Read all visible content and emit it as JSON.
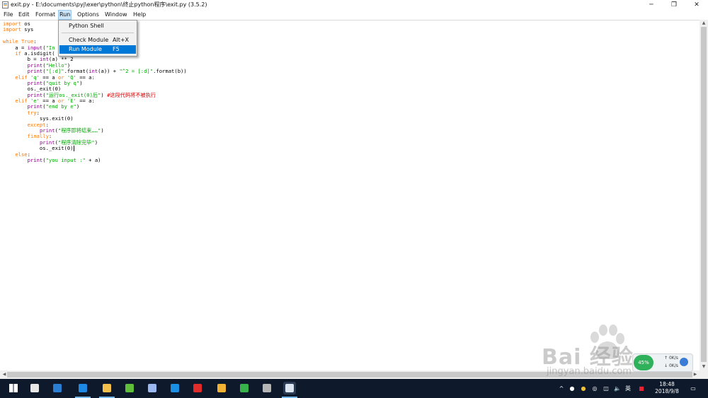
{
  "window": {
    "title": "exit.py - E:\\documents\\pyj\\exer\\python\\终止python程序\\exit.py (3.5.2)",
    "minimize_glyph": "─",
    "maximize_glyph": "❐",
    "close_glyph": "✕"
  },
  "menubar": {
    "items": [
      {
        "label": "File"
      },
      {
        "label": "Edit"
      },
      {
        "label": "Format"
      },
      {
        "label": "Run"
      },
      {
        "label": "Options"
      },
      {
        "label": "Window"
      },
      {
        "label": "Help"
      }
    ],
    "open_menu": "Run"
  },
  "run_menu": {
    "items": [
      {
        "label": "Python Shell",
        "accelerator": ""
      },
      {
        "label": "Check Module",
        "accelerator": "Alt+X"
      },
      {
        "label": "Run Module",
        "accelerator": "F5"
      }
    ],
    "selected": "Run Module"
  },
  "code_lines": [
    [
      {
        "t": "import",
        "c": "kw"
      },
      {
        "t": " os"
      }
    ],
    [
      {
        "t": "import",
        "c": "kw"
      },
      {
        "t": " sys"
      }
    ],
    [],
    [
      {
        "t": "while",
        "c": "kw"
      },
      {
        "t": " "
      },
      {
        "t": "True",
        "c": "kw"
      },
      {
        "t": ":"
      }
    ],
    [
      {
        "t": "    a = "
      },
      {
        "t": "input",
        "c": "bi"
      },
      {
        "t": "("
      },
      {
        "t": "\"In",
        "c": "str"
      }
    ],
    [
      {
        "t": "    "
      },
      {
        "t": "if",
        "c": "kw"
      },
      {
        "t": " a.isdigit("
      }
    ],
    [
      {
        "t": "        b = "
      },
      {
        "t": "int",
        "c": "bi"
      },
      {
        "t": "(a) ** 2"
      }
    ],
    [
      {
        "t": "        "
      },
      {
        "t": "print",
        "c": "bi"
      },
      {
        "t": "("
      },
      {
        "t": "\"Hello\"",
        "c": "str"
      },
      {
        "t": ")"
      }
    ],
    [
      {
        "t": "        "
      },
      {
        "t": "print",
        "c": "bi"
      },
      {
        "t": "("
      },
      {
        "t": "\"[:d]\"",
        "c": "str"
      },
      {
        "t": ".format("
      },
      {
        "t": "int",
        "c": "bi"
      },
      {
        "t": "(a)) + "
      },
      {
        "t": "\"^2 = [:d]\"",
        "c": "str"
      },
      {
        "t": ".format(b))"
      }
    ],
    [
      {
        "t": "    "
      },
      {
        "t": "elif",
        "c": "kw"
      },
      {
        "t": " "
      },
      {
        "t": "'q'",
        "c": "str"
      },
      {
        "t": " == a "
      },
      {
        "t": "or",
        "c": "kw"
      },
      {
        "t": " "
      },
      {
        "t": "'Q'",
        "c": "str"
      },
      {
        "t": " == a:"
      }
    ],
    [
      {
        "t": "        "
      },
      {
        "t": "print",
        "c": "bi"
      },
      {
        "t": "("
      },
      {
        "t": "\"quit by q\"",
        "c": "str"
      },
      {
        "t": ")"
      }
    ],
    [
      {
        "t": "        os._exit(0)"
      }
    ],
    [
      {
        "t": "        "
      },
      {
        "t": "print",
        "c": "bi"
      },
      {
        "t": "("
      },
      {
        "t": "\"运行os._exit(0)后\"",
        "c": "str"
      },
      {
        "t": ") "
      },
      {
        "t": "#这段代码将不被执行",
        "c": "cm"
      }
    ],
    [
      {
        "t": "    "
      },
      {
        "t": "elif",
        "c": "kw"
      },
      {
        "t": " "
      },
      {
        "t": "'e'",
        "c": "str"
      },
      {
        "t": " == a "
      },
      {
        "t": "or",
        "c": "kw"
      },
      {
        "t": " "
      },
      {
        "t": "'E'",
        "c": "str"
      },
      {
        "t": " == a:"
      }
    ],
    [
      {
        "t": "        "
      },
      {
        "t": "print",
        "c": "bi"
      },
      {
        "t": "("
      },
      {
        "t": "\"end by e\"",
        "c": "str"
      },
      {
        "t": ")"
      }
    ],
    [
      {
        "t": "        "
      },
      {
        "t": "try",
        "c": "kw"
      },
      {
        "t": ":"
      }
    ],
    [
      {
        "t": "            sys.exit(0)"
      }
    ],
    [
      {
        "t": "        "
      },
      {
        "t": "except",
        "c": "kw"
      },
      {
        "t": ":"
      }
    ],
    [
      {
        "t": "            "
      },
      {
        "t": "print",
        "c": "bi"
      },
      {
        "t": "("
      },
      {
        "t": "\"程序即将结束……\"",
        "c": "str"
      },
      {
        "t": ")"
      }
    ],
    [
      {
        "t": "        "
      },
      {
        "t": "finally",
        "c": "kw"
      },
      {
        "t": ":"
      }
    ],
    [
      {
        "t": "            "
      },
      {
        "t": "print",
        "c": "bi"
      },
      {
        "t": "("
      },
      {
        "t": "\"程序清除完毕\"",
        "c": "str"
      },
      {
        "t": ")"
      }
    ],
    [
      {
        "t": "            os._exit(0)"
      },
      {
        "caret": true
      }
    ],
    [
      {
        "t": "    "
      },
      {
        "t": "else",
        "c": "kw"
      },
      {
        "t": ":"
      }
    ],
    [
      {
        "t": "        "
      },
      {
        "t": "print",
        "c": "bi"
      },
      {
        "t": "("
      },
      {
        "t": "\"you input :\"",
        "c": "str"
      },
      {
        "t": " + a)"
      }
    ]
  ],
  "watermark": {
    "brand": "Bai  经验",
    "url": "jingyan.baidu.com"
  },
  "net_widget": {
    "percent": "45%",
    "up": "0K/s",
    "down": "0K/s"
  },
  "taskbar": {
    "ime_label": "英",
    "time": "18:48",
    "date": "2018/9/8",
    "apps": [
      {
        "name": "start-button-icon",
        "color": "#ffffff"
      },
      {
        "name": "app-pinwheel-icon",
        "color": "#e6e6e6"
      },
      {
        "name": "ie-browser-icon",
        "color": "#2a7fd4"
      },
      {
        "name": "edge-browser-icon",
        "color": "#1e88e5"
      },
      {
        "name": "file-explorer-icon",
        "color": "#f3c04b"
      },
      {
        "name": "wechat-like-icon",
        "color": "#5fbf3a"
      },
      {
        "name": "app-bird-icon",
        "color": "#9bb8f0"
      },
      {
        "name": "qq-icon",
        "color": "#1a8fe3"
      },
      {
        "name": "app-red-icon",
        "color": "#e22b2b"
      },
      {
        "name": "app-yellow-icon",
        "color": "#f2b233"
      },
      {
        "name": "app-green-icon",
        "color": "#38b24a"
      },
      {
        "name": "app-terminal-icon",
        "color": "#b5b5b5"
      },
      {
        "name": "python-idle-icon",
        "color": "#dce6f2"
      }
    ],
    "colors": {
      "background": "#0e1a2b",
      "accent": "#76b9ed"
    }
  }
}
